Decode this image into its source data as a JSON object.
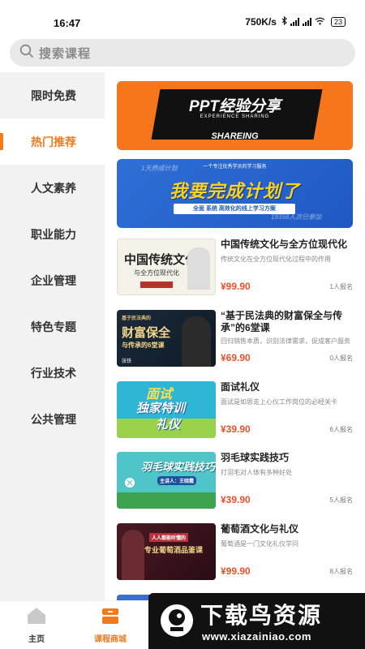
{
  "status": {
    "time": "16:47",
    "speed": "750K/s",
    "battery": "23"
  },
  "search": {
    "placeholder": "搜索课程"
  },
  "sidebar": {
    "items": [
      {
        "label": "限时免费"
      },
      {
        "label": "热门推荐"
      },
      {
        "label": "人文素养"
      },
      {
        "label": "职业能力"
      },
      {
        "label": "企业管理"
      },
      {
        "label": "特色专题"
      },
      {
        "label": "行业技术"
      },
      {
        "label": "公共管理"
      }
    ]
  },
  "banners": [
    {
      "title": "PPT经验分享",
      "subtitle": "EXPERIENCE SHARING",
      "tagline": "SHAREING"
    },
    {
      "title": "我要完成计划了",
      "tagline": "一个专注优秀学员的学习服务",
      "strip": "全面 系统 高效化的线上学习方案",
      "deco_left": "1天养成计划",
      "deco_right": "19358人次已参加"
    }
  ],
  "courses": [
    {
      "title": "中国传统文化与全方位现代化",
      "desc": "传统文化在全方位现代化过程中的作用",
      "price": "¥99.90",
      "enroll": "1人报名",
      "thumb_lines": [
        "中国传统文化",
        "与全方位现代化"
      ]
    },
    {
      "title": "“基于民法典的财富保全与传承”的6堂课",
      "desc": "回归销售本质，识别法律需求，促成客户服务",
      "price": "¥69.90",
      "enroll": "0人报名",
      "thumb_lines": [
        "基于民法典的",
        "财富保全",
        "与传承的6堂课",
        "张铁"
      ]
    },
    {
      "title": "面试礼仪",
      "desc": "面试是如思走上心仪工作岗位的必经关卡",
      "price": "¥39.90",
      "enroll": "6人报名",
      "thumb_lines": [
        "面试",
        "独家特训",
        "礼仪"
      ]
    },
    {
      "title": "羽毛球实践技巧",
      "desc": "打羽毛对人体有多种好处",
      "price": "¥39.90",
      "enroll": "5人报名",
      "thumb_lines": [
        "羽毛球实践技巧",
        "主讲人：王晓霞"
      ]
    },
    {
      "title": "葡萄酒文化与礼仪",
      "desc": "葡萄酒是一门文化礼仪学问",
      "price": "¥99.90",
      "enroll": "8人报名",
      "thumb_lines": [
        "人人都能听懂的",
        "专业葡萄酒品鉴课"
      ]
    }
  ],
  "tabbar": {
    "items": [
      {
        "label": "主页"
      },
      {
        "label": "课程商城"
      }
    ]
  },
  "watermark": {
    "title": "下载鸟资源",
    "url": "www.xiazainiao.com"
  },
  "colors": {
    "accent": "#f07a1e",
    "price": "#e8522a"
  }
}
